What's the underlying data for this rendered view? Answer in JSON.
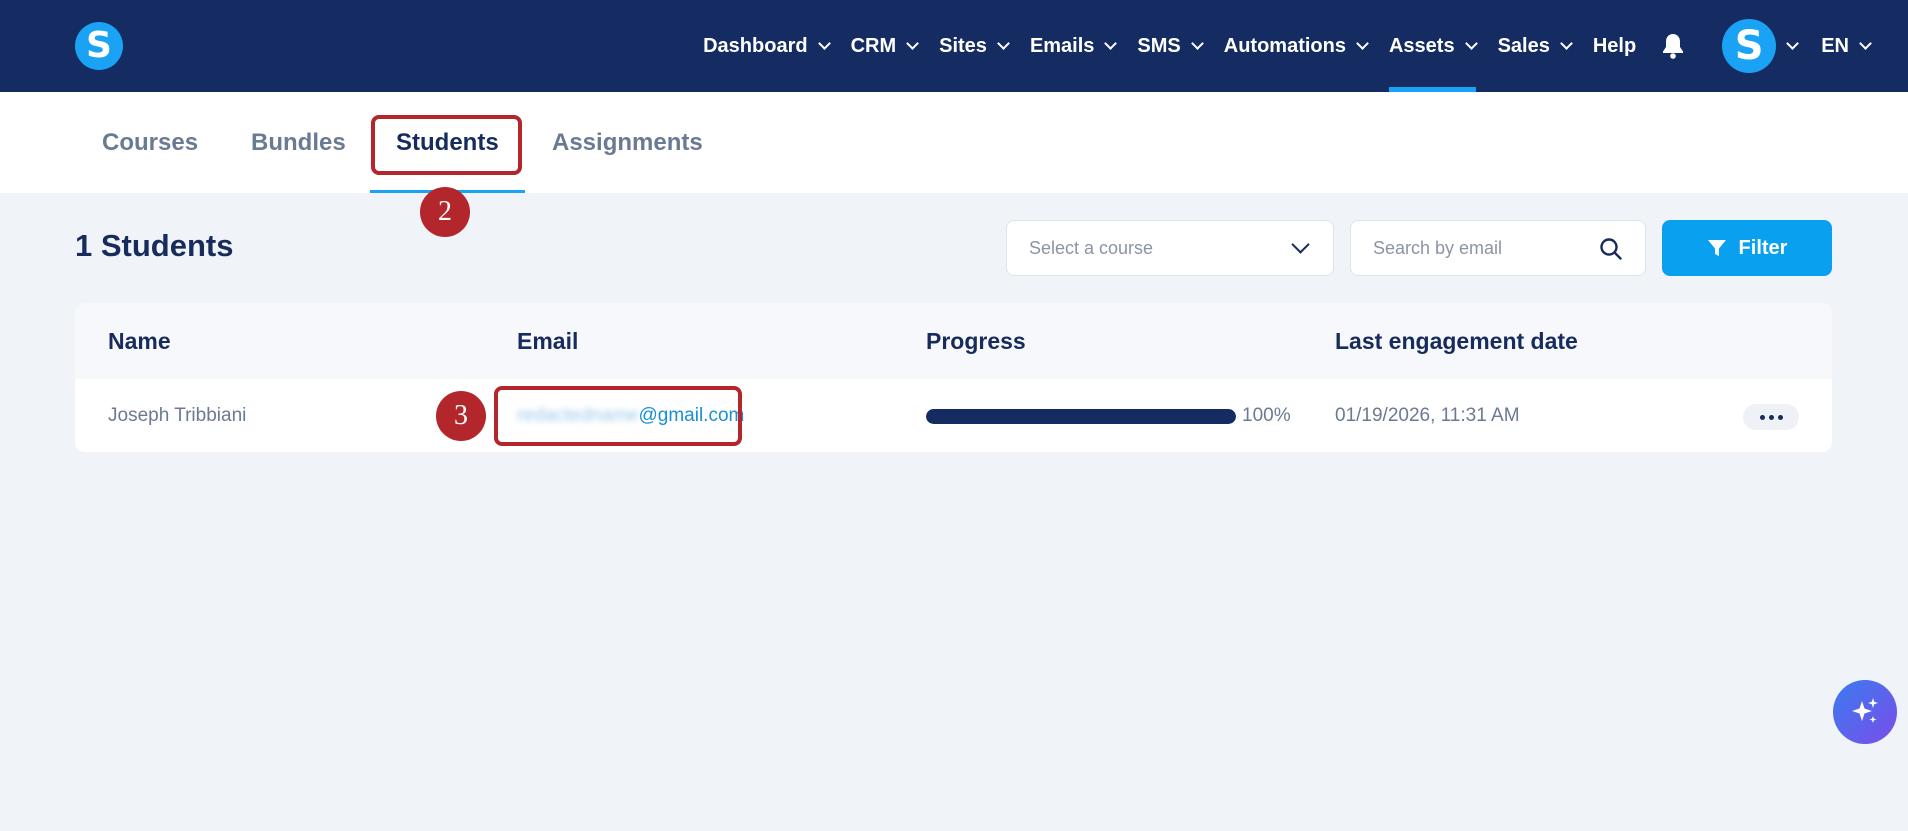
{
  "brand": {
    "logo_letter": "S"
  },
  "nav": {
    "items": [
      {
        "label": "Dashboard",
        "dropdown": true
      },
      {
        "label": "CRM",
        "dropdown": true
      },
      {
        "label": "Sites",
        "dropdown": true
      },
      {
        "label": "Emails",
        "dropdown": true
      },
      {
        "label": "SMS",
        "dropdown": true
      },
      {
        "label": "Automations",
        "dropdown": true
      },
      {
        "label": "Assets",
        "dropdown": true,
        "active": true
      },
      {
        "label": "Sales",
        "dropdown": true
      },
      {
        "label": "Help",
        "dropdown": false
      }
    ],
    "avatar_letter": "S",
    "language": "EN"
  },
  "subtabs": [
    {
      "label": "Courses"
    },
    {
      "label": "Bundles"
    },
    {
      "label": "Students",
      "active": true
    },
    {
      "label": "Assignments"
    }
  ],
  "annotations": {
    "step_tab": "2",
    "step_email": "3"
  },
  "toolbar": {
    "title": "1 Students",
    "course_select_placeholder": "Select a course",
    "search_placeholder": "Search by email",
    "filter_label": "Filter"
  },
  "table": {
    "headers": [
      "Name",
      "Email",
      "Progress",
      "Last engagement date"
    ],
    "rows": [
      {
        "name": "Joseph Tribbiani",
        "email_hidden": "redactedname",
        "email_domain": "@gmail.com",
        "progress": 100,
        "progress_label": "100%",
        "last_engagement": "01/19/2026, 11:31 AM"
      }
    ]
  },
  "colors": {
    "nav_bg": "#152c62",
    "accent": "#1aa3f5",
    "annotation": "#b3262b"
  },
  "icons": {
    "notifications": "bell-icon",
    "search": "search-icon",
    "filter": "filter-icon",
    "more": "more-icon",
    "ai": "sparkle-icon"
  }
}
